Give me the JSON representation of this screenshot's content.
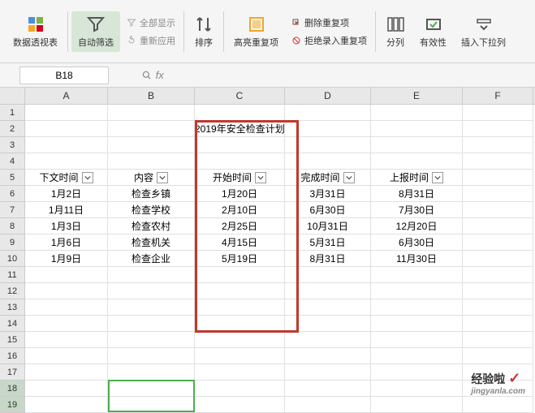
{
  "ribbon": {
    "pivot": "数据透视表",
    "autofilter": "自动筛选",
    "showall": "全部显示",
    "reapply": "重新应用",
    "sort": "排序",
    "highlight_dup": "高亮重复项",
    "remove_dup": "删除重复项",
    "reject_dup": "拒绝录入重复项",
    "text_to_col": "分列",
    "validation": "有效性",
    "insert_dropdown": "插入下拉列"
  },
  "namebox": {
    "value": "B18",
    "fx": "fx"
  },
  "columns": [
    "A",
    "B",
    "C",
    "D",
    "E",
    "F"
  ],
  "rows": [
    "1",
    "2",
    "3",
    "4",
    "5",
    "6",
    "7",
    "8",
    "9",
    "10",
    "11",
    "12",
    "13",
    "14",
    "15",
    "16",
    "17",
    "18",
    "19"
  ],
  "title": "2019年安全检查计划",
  "headers": {
    "c1": "下文时间",
    "c2": "内容",
    "c3": "开始时间",
    "c4": "完成时间",
    "c5": "上报时间"
  },
  "chart_data": {
    "type": "table",
    "title": "2019年安全检查计划",
    "columns": [
      "下文时间",
      "内容",
      "开始时间",
      "完成时间",
      "上报时间"
    ],
    "rows": [
      [
        "1月2日",
        "检查乡镇",
        "1月20日",
        "3月31日",
        "8月31日"
      ],
      [
        "1月11日",
        "检查学校",
        "2月10日",
        "6月30日",
        "7月30日"
      ],
      [
        "1月3日",
        "检查农村",
        "2月25日",
        "10月31日",
        "12月20日"
      ],
      [
        "1月6日",
        "检查机关",
        "4月15日",
        "5月31日",
        "6月30日"
      ],
      [
        "1月9日",
        "检查企业",
        "5月19日",
        "8月31日",
        "11月30日"
      ]
    ]
  },
  "watermark": {
    "text": "经验啦",
    "sub": "jingyanla.com"
  }
}
